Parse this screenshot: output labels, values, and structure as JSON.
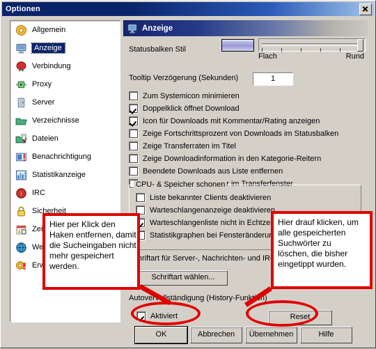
{
  "window": {
    "title": "Optionen",
    "close_label": "close-icon"
  },
  "sidebar": {
    "items": [
      {
        "label": "Allgemein",
        "icon": "gear-icon",
        "selected": false
      },
      {
        "label": "Anzeige",
        "icon": "monitor-icon",
        "selected": true
      },
      {
        "label": "Verbindung",
        "icon": "plug-icon",
        "selected": false
      },
      {
        "label": "Proxy",
        "icon": "proxy-icon",
        "selected": false
      },
      {
        "label": "Server",
        "icon": "server-icon",
        "selected": false
      },
      {
        "label": "Verzeichnisse",
        "icon": "folder-icon",
        "selected": false
      },
      {
        "label": "Dateien",
        "icon": "files-icon",
        "selected": false
      },
      {
        "label": "Benachrichtigung",
        "icon": "notify-icon",
        "selected": false
      },
      {
        "label": "Statistikanzeige",
        "icon": "chart-icon",
        "selected": false
      },
      {
        "label": "IRC",
        "icon": "irc-icon",
        "selected": false
      },
      {
        "label": "Sicherheit",
        "icon": "lock-icon",
        "selected": false
      },
      {
        "label": "Zeitplan",
        "icon": "calendar-icon",
        "selected": false
      },
      {
        "label": "Web",
        "icon": "globe-icon",
        "selected": false
      },
      {
        "label": "Erweitert",
        "icon": "advanced-icon",
        "selected": false
      }
    ]
  },
  "panel": {
    "header": "Anzeige",
    "header_icon": "monitor-icon",
    "statusbar_style_label": "Statusbalken Stil",
    "slider_min_label": "Flach",
    "slider_max_label": "Rund",
    "slider_value_percent": 100,
    "tooltip_label": "Tooltip Verzögerung (Sekunden)",
    "tooltip_value": "1",
    "checkboxes": [
      {
        "label": "Zum Systemicon minimieren",
        "checked": false
      },
      {
        "label": "Doppelklick öffnet Download",
        "checked": true
      },
      {
        "label": "Icon für Downloads mit Kommentar/Rating anzeigen",
        "checked": true
      },
      {
        "label": "Zeige Fortschrittsprozent von Downloads im Statusbalken",
        "checked": false
      },
      {
        "label": "Zeige Transferraten im Titel",
        "checked": false
      },
      {
        "label": "Zeige Downloadinformation in den Kategorie-Reitern",
        "checked": false
      },
      {
        "label": "Beendete Downloads aus Liste entfernen",
        "checked": false
      },
      {
        "label": "Zeige zusätzliche Toolbar im Transferfenster",
        "checked": false
      }
    ],
    "group": {
      "title": "CPU- & Speicher schonen",
      "checkboxes": [
        {
          "label": "Liste bekannter Clients deaktivieren",
          "checked": false
        },
        {
          "label": "Warteschlangenanzeige deaktivieren",
          "checked": false
        },
        {
          "label": "Warteschlangenliste nicht in Echtzeit",
          "checked": true
        },
        {
          "label": "Statistikgraphen bei Fensteränderung",
          "checked": false
        }
      ]
    },
    "font_label": "Schriftart für Server-, Nachrichten- und IRC-Fenster",
    "font_button": "Schriftart wählen...",
    "autocomplete_label": "Autovervollständigung (History-Funktion)",
    "autocomplete_checkbox": {
      "label": "Aktiviert",
      "checked": true
    },
    "reset_button": "Reset"
  },
  "footer": {
    "buttons": [
      {
        "label": "OK",
        "default": true
      },
      {
        "label": "Abbrechen",
        "default": false
      },
      {
        "label": "Übernehmen",
        "default": false
      },
      {
        "label": "Hilfe",
        "default": false
      }
    ]
  },
  "annotations": {
    "left": {
      "lines": [
        "Hier per Klick den",
        "Haken entfernen, damit",
        "die Sucheingaben nicht",
        "mehr gespeichert",
        "werden."
      ]
    },
    "right": {
      "lines": [
        "Hier drauf klicken, um",
        "alle gespeicherten",
        "Suchwörter zu",
        "löschen, die bisher",
        "eingetippt wurden."
      ]
    },
    "color": "#e00000"
  }
}
